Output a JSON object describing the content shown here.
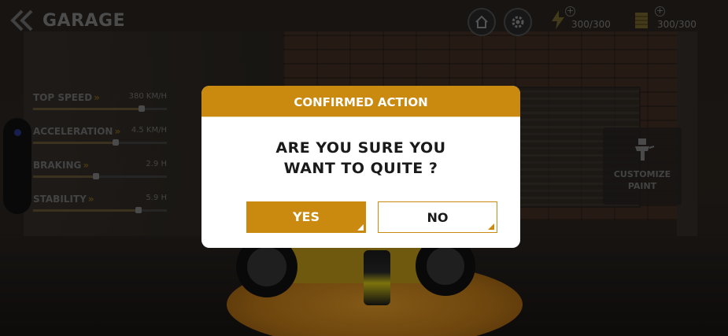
{
  "header": {
    "back_icon": "double-chevron-left-icon",
    "title": "GARAGE",
    "home_icon": "home-icon",
    "settings_icon": "gear-icon",
    "energy": {
      "icon": "lightning-icon",
      "value": "300/300",
      "plus": "+"
    },
    "coins": {
      "icon": "coin-stack-icon",
      "value": "300/300",
      "plus": "+"
    }
  },
  "stats": [
    {
      "label": "TOP SPEED",
      "value": "380 KM/H",
      "level": 0.81
    },
    {
      "label": "ACCELERATION",
      "value": "4.5 KM/H",
      "level": 0.62
    },
    {
      "label": "BRAKING",
      "value": "2.9 H",
      "level": 0.47
    },
    {
      "label": "STABILITY",
      "value": "5.9 H",
      "level": 0.79
    }
  ],
  "customize": {
    "icon": "spray-gun-icon",
    "line1": "CUSTOMIZE",
    "line2": "PAINT"
  },
  "dialog": {
    "title": "CONFIRMED ACTION",
    "line1": "ARE YOU SURE YOU",
    "line2": "WANT TO QUITE ?",
    "yes_label": "YES",
    "no_label": "NO"
  },
  "colors": {
    "accent": "#c98a0f",
    "dialog_bg": "#ffffff",
    "text_dark": "#1a1a1a"
  }
}
